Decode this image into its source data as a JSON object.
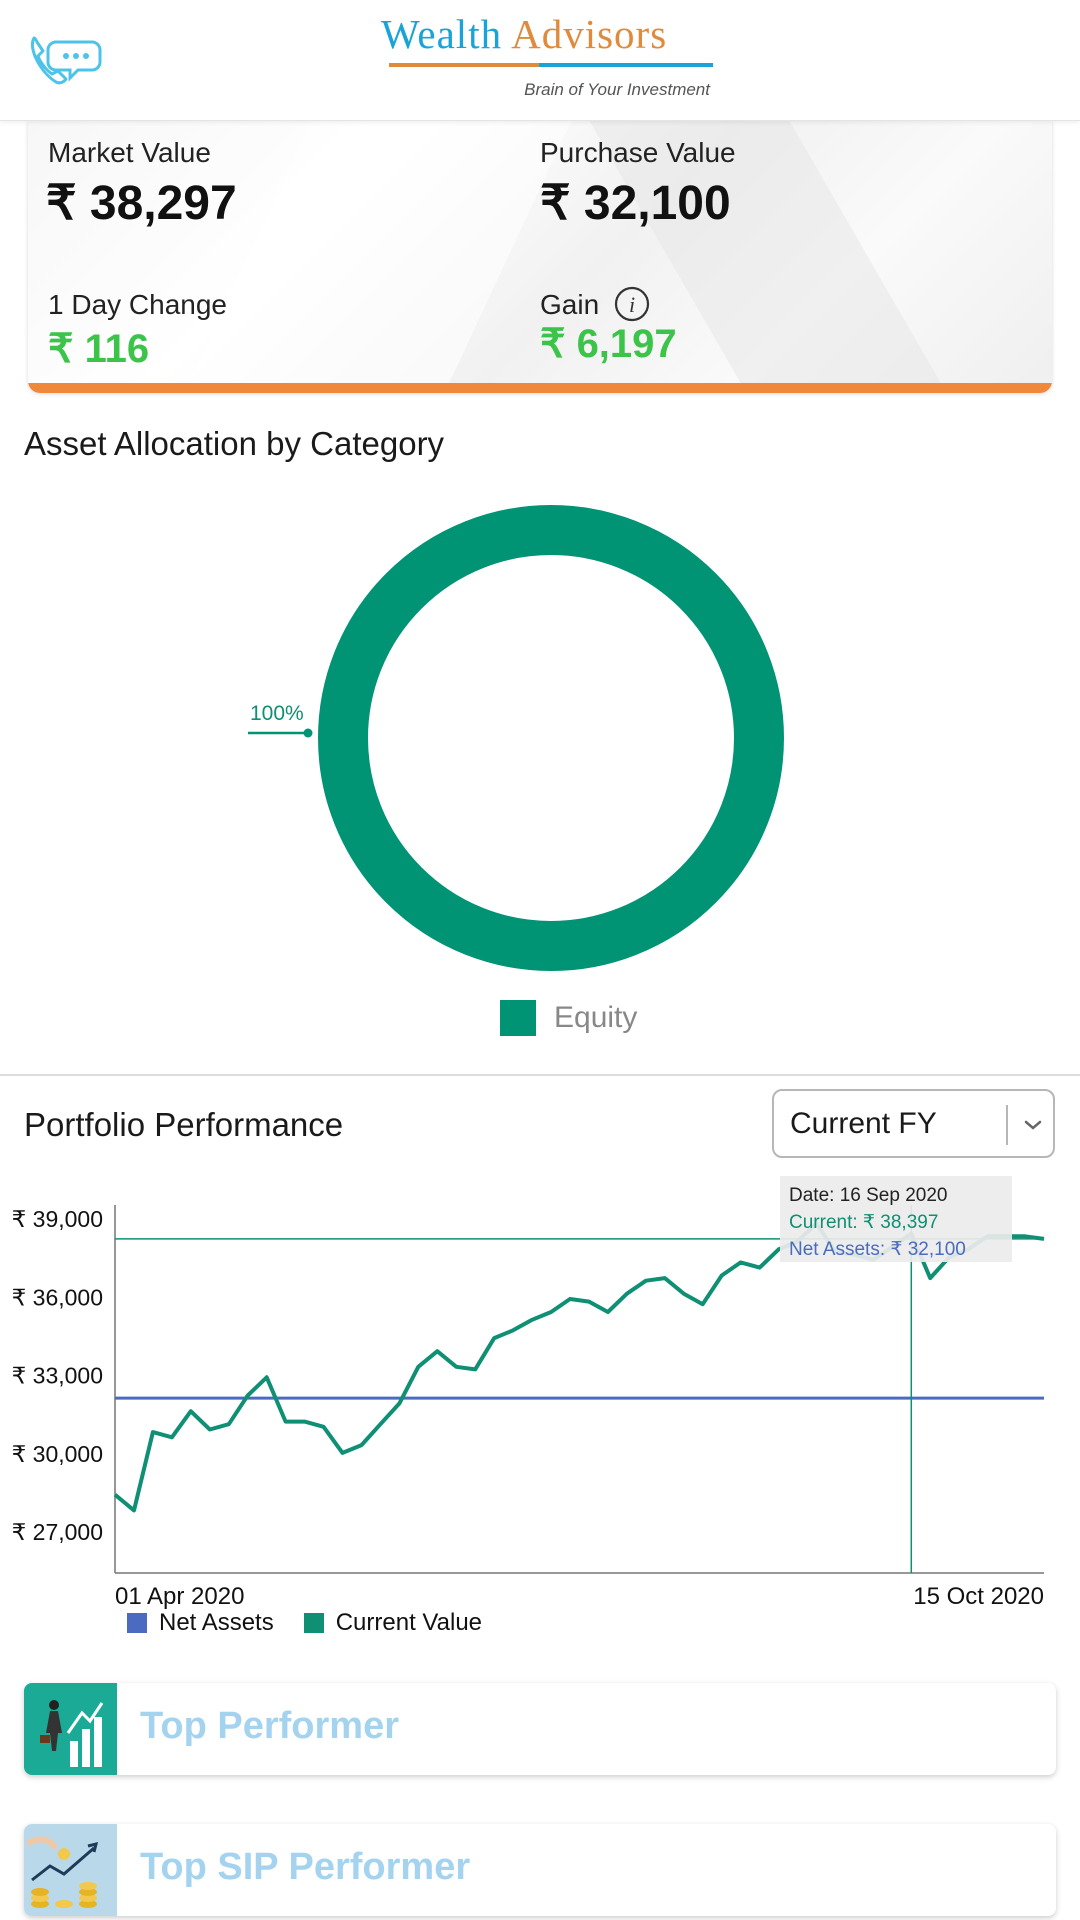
{
  "header": {
    "logo_word1": "Wealth",
    "logo_word2": "Advisors",
    "tagline": "Brain of Your Investment",
    "call_icon": "phone-chat-icon"
  },
  "summary": {
    "market_value_label": "Market Value",
    "market_value": "₹ 38,297",
    "purchase_value_label": "Purchase Value",
    "purchase_value": "₹ 32,100",
    "day_change_label": "1 Day Change",
    "day_change": "₹ 116",
    "gain_label": "Gain",
    "gain": "₹ 6,197",
    "info_icon": "info-icon"
  },
  "allocation": {
    "title": "Asset Allocation by Category",
    "slices": [
      {
        "name": "Equity",
        "percent": 100,
        "label": "100%",
        "color": "#009475"
      }
    ]
  },
  "performance": {
    "title": "Portfolio Performance",
    "period_selected": "Current FY",
    "tooltip": {
      "date": "Date: 16 Sep 2020",
      "current": "Current: ₹ 38,397",
      "net_assets": "Net Assets: ₹ 32,100"
    }
  },
  "chart_data": {
    "type": "line",
    "x_start_label": "01 Apr 2020",
    "x_end_label": "15 Oct 2020",
    "y_ticks": [
      "₹ 39,000",
      "₹ 36,000",
      "₹ 33,000",
      "₹ 30,000",
      "₹ 27,000"
    ],
    "y_tick_values": [
      39000,
      36000,
      33000,
      30000,
      27000
    ],
    "ylim": [
      25400,
      39500
    ],
    "series": [
      {
        "name": "Net Assets",
        "color": "#4a6bbf",
        "values": [
          32100,
          32100
        ]
      },
      {
        "name": "Current Value",
        "color": "#0f8f74",
        "values": [
          28400,
          27800,
          30800,
          30600,
          31600,
          30900,
          31100,
          32200,
          32900,
          31200,
          31200,
          31000,
          30000,
          30300,
          31100,
          31900,
          33300,
          33900,
          33300,
          33200,
          34400,
          34700,
          35100,
          35400,
          35900,
          35800,
          35400,
          36100,
          36600,
          36700,
          36100,
          35700,
          36800,
          37300,
          37100,
          37800,
          38100,
          38800,
          37700,
          37600,
          37400,
          37900,
          38400,
          36700,
          37500,
          37800,
          38300,
          38300,
          38300,
          38200
        ]
      }
    ]
  },
  "performers": [
    {
      "label": "Top Performer",
      "thumb_icon": "businessman-growth-icon",
      "thumb_bg": "#1aaa96"
    },
    {
      "label": "Top SIP Performer",
      "thumb_icon": "coins-growth-icon",
      "thumb_bg": "#b9d9ea"
    }
  ]
}
